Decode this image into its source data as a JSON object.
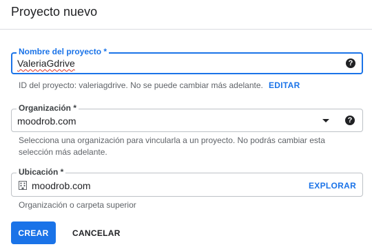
{
  "header": {
    "title": "Proyecto nuevo"
  },
  "project_name": {
    "label": "Nombre del proyecto *",
    "value": "ValeriaGdrive",
    "help_icon": "help-circle-icon",
    "id_hint": "ID del proyecto: valeriagdrive. No se puede cambiar más adelante.",
    "edit_label": "EDITAR"
  },
  "organization": {
    "label": "Organización *",
    "value": "moodrob.com",
    "dropdown_icon": "caret-down-icon",
    "help_icon": "help-circle-icon",
    "hint_line1": "Selecciona una organización para vincularla a un proyecto. No podrás cambiar esta",
    "hint_line2": "selección más adelante."
  },
  "location": {
    "label": "Ubicación *",
    "value": "moodrob.com",
    "icon": "building-icon",
    "browse_label": "EXPLORAR",
    "hint": "Organización o carpeta superior"
  },
  "actions": {
    "create_label": "CREAR",
    "cancel_label": "CANCELAR"
  },
  "colors": {
    "accent": "#1a73e8",
    "text": "#202124",
    "hint": "#5f6368",
    "border": "#bdc1c6"
  }
}
